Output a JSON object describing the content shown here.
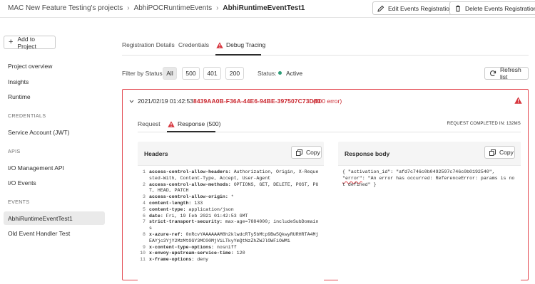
{
  "breadcrumb": {
    "items": [
      "MAC New Feature Testing's projects",
      "AbhiPOCRuntimeEvents"
    ],
    "current": "AbhiRuntimeEventTest1"
  },
  "header_actions": {
    "edit_label": "Edit Events Registration",
    "delete_label": "Delete Events Registration"
  },
  "sidebar": {
    "add_label": "Add to Project",
    "items_top": [
      "Project overview",
      "Insights",
      "Runtime"
    ],
    "credentials_heading": "CREDENTIALS",
    "credentials_items": [
      "Service Account (JWT)"
    ],
    "apis_heading": "APIS",
    "apis_items": [
      "I/O Management API",
      "I/O Events"
    ],
    "events_heading": "EVENTS",
    "events_items": [
      "AbhiRuntimeEventTest1",
      "Old Event Handler Test"
    ]
  },
  "tabs": {
    "registration": "Registration Details",
    "credentials": "Credentials",
    "debug": "Debug Tracing"
  },
  "filter": {
    "label": "Filter by Status:",
    "options": [
      "All",
      "500",
      "401",
      "200"
    ],
    "selected": "All",
    "status_label": "Status:",
    "status_value": "Active",
    "status_color": "#2d9d78",
    "refresh_label": "Refresh list"
  },
  "trace": {
    "timestamp": "2021/02/19 01:42:53",
    "request_id": "8439AA0B-F36A-44E6-94BE-397507C73D80",
    "status_text": "(500 error)",
    "error_color": "#c9252d",
    "subtabs": {
      "request": "Request",
      "response": "Response (500)"
    },
    "completed": "REQUEST COMPLETED IN: 132MS",
    "headers_title": "Headers",
    "body_title": "Response body",
    "copy_label": "Copy",
    "headers": [
      {
        "n": "1",
        "k": "access-control-allow-headers:",
        "v": " Authorization, Origin, X-Requested-With, Content-Type, Accept, User-Agent"
      },
      {
        "n": "2",
        "k": "access-control-allow-methods:",
        "v": " OPTIONS, GET, DELETE, POST, PUT, HEAD, PATCH"
      },
      {
        "n": "3",
        "k": "access-control-allow-origin:",
        "v": " *"
      },
      {
        "n": "4",
        "k": "content-length:",
        "v": " 133"
      },
      {
        "n": "5",
        "k": "content-type:",
        "v": " application/json"
      },
      {
        "n": "6",
        "k": "date:",
        "v": " Fri, 19 Feb 2021 01:42:53 GMT"
      },
      {
        "n": "7",
        "k": "strict-transport-security:",
        "v": " max-age=7884000; includeSubDomains"
      },
      {
        "n": "8",
        "k": "x-azure-ref:",
        "v": " 0nRcvYAAAAAAM8h2klwdcRTy5bMtp9Bw5QkwyRURHRTA4MjEAYjc3YjY2MzMtOGY3MC00MjViLTkyYmQtNzZhZWJlOWFiOWMi"
      },
      {
        "n": "9",
        "k": "x-content-type-options:",
        "v": " nosniff"
      },
      {
        "n": "10",
        "k": "x-envoy-upstream-service-time:",
        "v": " 120"
      },
      {
        "n": "11",
        "k": "x-frame-options:",
        "v": " deny"
      }
    ],
    "body_line1": "{ \"activation_id\": \"afd7c746c0b0492597c746c0b0192540\",",
    "body_err_key": "\"error\"",
    "body_rest": ": \"An error has occurred: ReferenceError: params is not defined\" }"
  }
}
